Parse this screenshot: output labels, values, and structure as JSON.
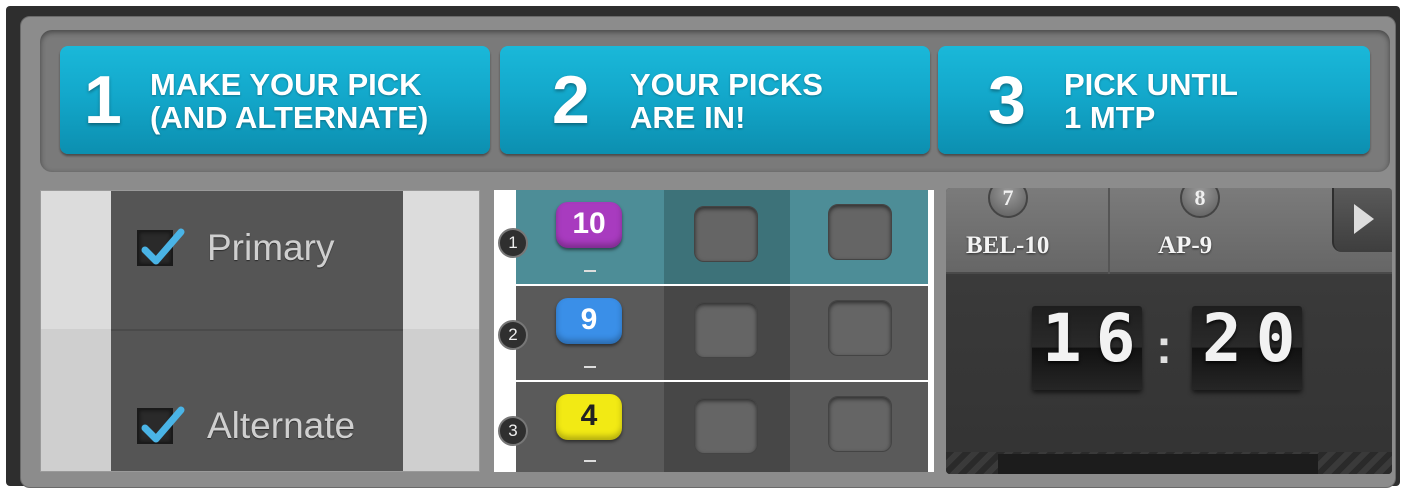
{
  "steps": [
    {
      "number": "1",
      "text": "MAKE YOUR PICK\n(AND ALTERNATE)"
    },
    {
      "number": "2",
      "text": "YOUR PICKS\nARE IN!"
    },
    {
      "number": "3",
      "text": "PICK UNTIL\n1 MTP"
    }
  ],
  "pick_types": [
    {
      "label": "Primary",
      "checked": true
    },
    {
      "label": "Alternate",
      "checked": true
    }
  ],
  "runners": [
    {
      "row": "1",
      "saddle": "10",
      "saddle_color": "#a83bbf",
      "saddle_text_color": "#ffffff"
    },
    {
      "row": "2",
      "saddle": "9",
      "saddle_color": "#3a8fe8",
      "saddle_text_color": "#ffffff"
    },
    {
      "row": "3",
      "saddle": "4",
      "saddle_color": "#f2ea14",
      "saddle_text_color": "#222222"
    }
  ],
  "races": [
    {
      "number": "7",
      "label": "BEL-10"
    },
    {
      "number": "8",
      "label": "AP-9"
    }
  ],
  "clock": {
    "hours": "16",
    "separator": ":",
    "minutes": "20"
  },
  "colors": {
    "accent": "#13a8cb",
    "selected_row": "#4a8a93"
  }
}
